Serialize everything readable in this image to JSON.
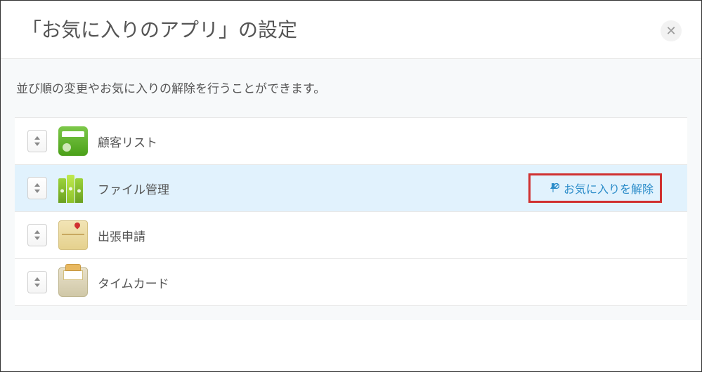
{
  "dialog": {
    "title": "「お気に入りのアプリ」の設定",
    "description": "並び順の変更やお気に入りの解除を行うことができます。"
  },
  "items": [
    {
      "name": "顧客リスト",
      "icon": "contact-icon",
      "highlighted": false
    },
    {
      "name": "ファイル管理",
      "icon": "files-icon",
      "highlighted": true,
      "remove_label": "お気に入りを解除"
    },
    {
      "name": "出張申請",
      "icon": "map-icon",
      "highlighted": false
    },
    {
      "name": "タイムカード",
      "icon": "timecard-icon",
      "highlighted": false
    }
  ]
}
